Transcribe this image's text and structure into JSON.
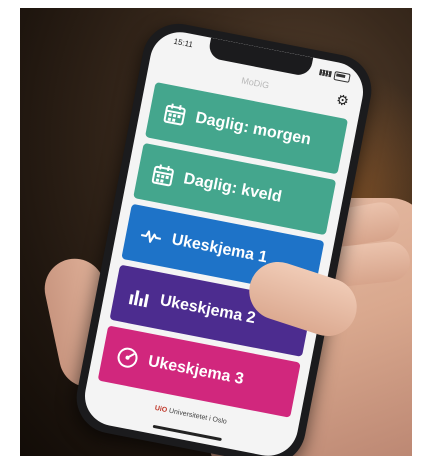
{
  "statusbar": {
    "time": "15:11"
  },
  "header": {
    "title": "MoDiG"
  },
  "buttons": [
    {
      "label": "Daglig: morgen",
      "icon": "calendar-icon",
      "color": "#44a68d"
    },
    {
      "label": "Daglig: kveld",
      "icon": "calendar-icon",
      "color": "#44a68d"
    },
    {
      "label": "Ukeskjema 1",
      "icon": "pulse-icon",
      "color": "#1e73c8"
    },
    {
      "label": "Ukeskjema 2",
      "icon": "bar-chart-icon",
      "color": "#4c2c8f"
    },
    {
      "label": "Ukeskjema 3",
      "icon": "gauge-icon",
      "color": "#d1277d"
    }
  ],
  "footer": {
    "logo_text": "UiO",
    "institution": "Universitetet i Oslo"
  }
}
